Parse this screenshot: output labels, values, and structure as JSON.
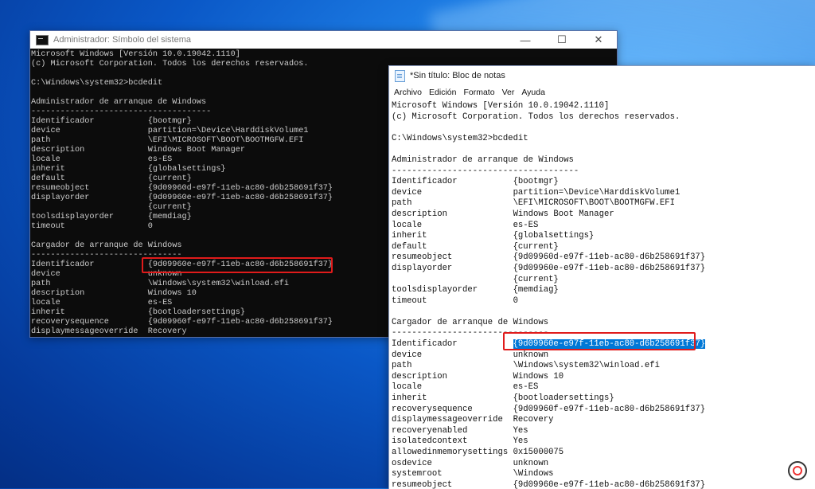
{
  "cmd": {
    "title": "Administrador: Símbolo del sistema",
    "lines": [
      "Microsoft Windows [Versión 10.0.19042.1110]",
      "(c) Microsoft Corporation. Todos los derechos reservados.",
      "",
      "C:\\Windows\\system32>bcdedit",
      "",
      "Administrador de arranque de Windows",
      "-------------------------------------",
      "Identificador           {bootmgr}",
      "device                  partition=\\Device\\HarddiskVolume1",
      "path                    \\EFI\\MICROSOFT\\BOOT\\BOOTMGFW.EFI",
      "description             Windows Boot Manager",
      "locale                  es-ES",
      "inherit                 {globalsettings}",
      "default                 {current}",
      "resumeobject            {9d09960d-e97f-11eb-ac80-d6b258691f37}",
      "displayorder            {9d09960e-e97f-11eb-ac80-d6b258691f37}",
      "                        {current}",
      "toolsdisplayorder       {memdiag}",
      "timeout                 0",
      "",
      "Cargador de arranque de Windows",
      "-------------------------------",
      "Identificador           {9d09960e-e97f-11eb-ac80-d6b258691f37}",
      "device                  unknown",
      "path                    \\Windows\\system32\\winload.efi",
      "description             Windows 10",
      "locale                  es-ES",
      "inherit                 {bootloadersettings}",
      "recoverysequence        {9d09960f-e97f-11eb-ac80-d6b258691f37}",
      "displaymessageoverride  Recovery"
    ]
  },
  "notepad": {
    "title": "*Sin título: Bloc de notas",
    "menu": [
      "Archivo",
      "Edición",
      "Formato",
      "Ver",
      "Ayuda"
    ],
    "lines": [
      "Microsoft Windows [Versión 10.0.19042.1110]",
      "(c) Microsoft Corporation. Todos los derechos reservados.",
      "",
      "C:\\Windows\\system32>bcdedit",
      "",
      "Administrador de arranque de Windows",
      "-------------------------------------",
      "Identificador           {bootmgr}",
      "device                  partition=\\Device\\HarddiskVolume1",
      "path                    \\EFI\\MICROSOFT\\BOOT\\BOOTMGFW.EFI",
      "description             Windows Boot Manager",
      "locale                  es-ES",
      "inherit                 {globalsettings}",
      "default                 {current}",
      "resumeobject            {9d09960d-e97f-11eb-ac80-d6b258691f37}",
      "displayorder            {9d09960e-e97f-11eb-ac80-d6b258691f37}",
      "                        {current}",
      "toolsdisplayorder       {memdiag}",
      "timeout                 0",
      "",
      "Cargador de arranque de Windows",
      "-------------------------------",
      "Identificador           {9d09960e-e97f-11eb-ac80-d6b258691f37}",
      "device                  unknown",
      "path                    \\Windows\\system32\\winload.efi",
      "description             Windows 10",
      "locale                  es-ES",
      "inherit                 {bootloadersettings}",
      "recoverysequence        {9d09960f-e97f-11eb-ac80-d6b258691f37}",
      "displaymessageoverride  Recovery",
      "recoveryenabled         Yes",
      "isolatedcontext         Yes",
      "allowedinmemorysettings 0x15000075",
      "osdevice                unknown",
      "systemroot              \\Windows",
      "resumeobject            {9d09960e-e97f-11eb-ac80-d6b258691f37}"
    ],
    "selected_line_index": 22,
    "selected_text": "{9d09960e-e97f-11eb-ac80-d6b258691f37}"
  },
  "icons": {
    "cmd_window": "command-prompt-icon",
    "notepad_window": "notepad-icon",
    "minimize": "minimize-icon",
    "maximize": "maximize-icon",
    "close": "close-icon",
    "badge": "channel-logo-icon"
  },
  "colors": {
    "cmd_bg": "#0c0c0c",
    "cmd_text": "#cccccc",
    "selection": "#0078d7",
    "highlight_box": "#e01b1b"
  }
}
